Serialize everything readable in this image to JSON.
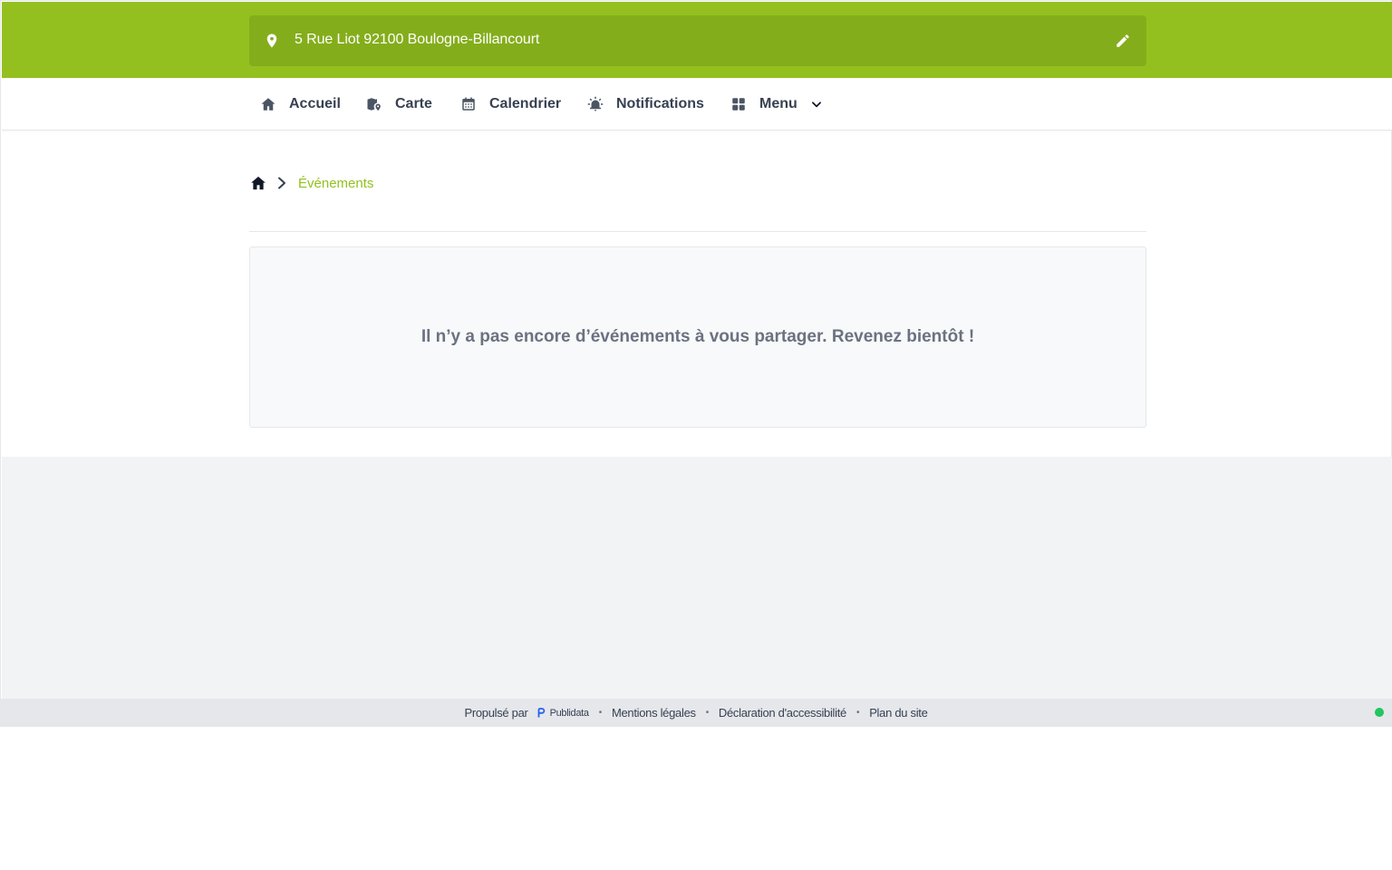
{
  "colors": {
    "brand": "#93c01f",
    "brand_dark": "#84ad1b",
    "text": "#374151",
    "muted": "#6b7280",
    "status_online": "#22c55e"
  },
  "header": {
    "address": "5 Rue Liot 92100 Boulogne-Billancourt",
    "pin_icon": "map-pin-icon",
    "edit_icon": "pencil-icon"
  },
  "nav": {
    "items": [
      {
        "label": "Accueil",
        "icon": "home-icon"
      },
      {
        "label": "Carte",
        "icon": "map-marker-icon"
      },
      {
        "label": "Calendrier",
        "icon": "calendar-icon"
      },
      {
        "label": "Notifications",
        "icon": "alarm-bell-icon"
      },
      {
        "label": "Menu",
        "icon": "grid-icon"
      }
    ],
    "menu_dropdown_icon": "chevron-down-icon"
  },
  "breadcrumb": {
    "home_icon": "home-icon",
    "separator_icon": "chevron-right-icon",
    "current": "Événements"
  },
  "main": {
    "empty_message": "Il n’y a pas encore d’événements à vous partager. Revenez bientôt !"
  },
  "footer": {
    "powered_by": "Propulsé par",
    "brand": "Publidata",
    "links": [
      "Mentions légales",
      "Déclaration d'accessibilité",
      "Plan du site"
    ],
    "separator": "•"
  }
}
